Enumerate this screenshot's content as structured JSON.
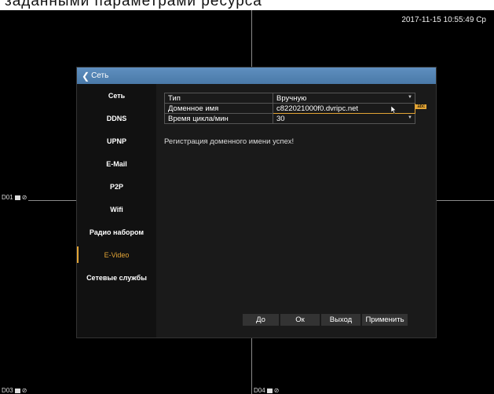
{
  "top_strip_text": "заданными параметрами ресурса",
  "timestamp": "2017-11-15 10:55:49 Ср",
  "cameras": {
    "d01": "D01",
    "d03": "D03",
    "d04": "D04"
  },
  "dialog": {
    "title": "Сеть",
    "sidebar": [
      {
        "label": "Сеть"
      },
      {
        "label": "DDNS"
      },
      {
        "label": "UPNP"
      },
      {
        "label": "E-Mail"
      },
      {
        "label": "P2P"
      },
      {
        "label": "Wifi"
      },
      {
        "label": "Радио набором"
      },
      {
        "label": "E-Video",
        "active": true
      },
      {
        "label": "Сетевые службы"
      }
    ],
    "fields": [
      {
        "label": "Тип",
        "value": "Вручную"
      },
      {
        "label": "Доменное имя",
        "value": "c822021000f0.dvripc.net",
        "badge": "abc"
      },
      {
        "label": "Время цикла/мин",
        "value": "30"
      }
    ],
    "status": "Регистрация доменного имени успех!",
    "buttons": {
      "up": "До",
      "ok": "Ок",
      "exit": "Выход",
      "apply": "Применить"
    }
  },
  "colors": {
    "accent": "#e2a435",
    "title_bar": "#5a89b8"
  }
}
